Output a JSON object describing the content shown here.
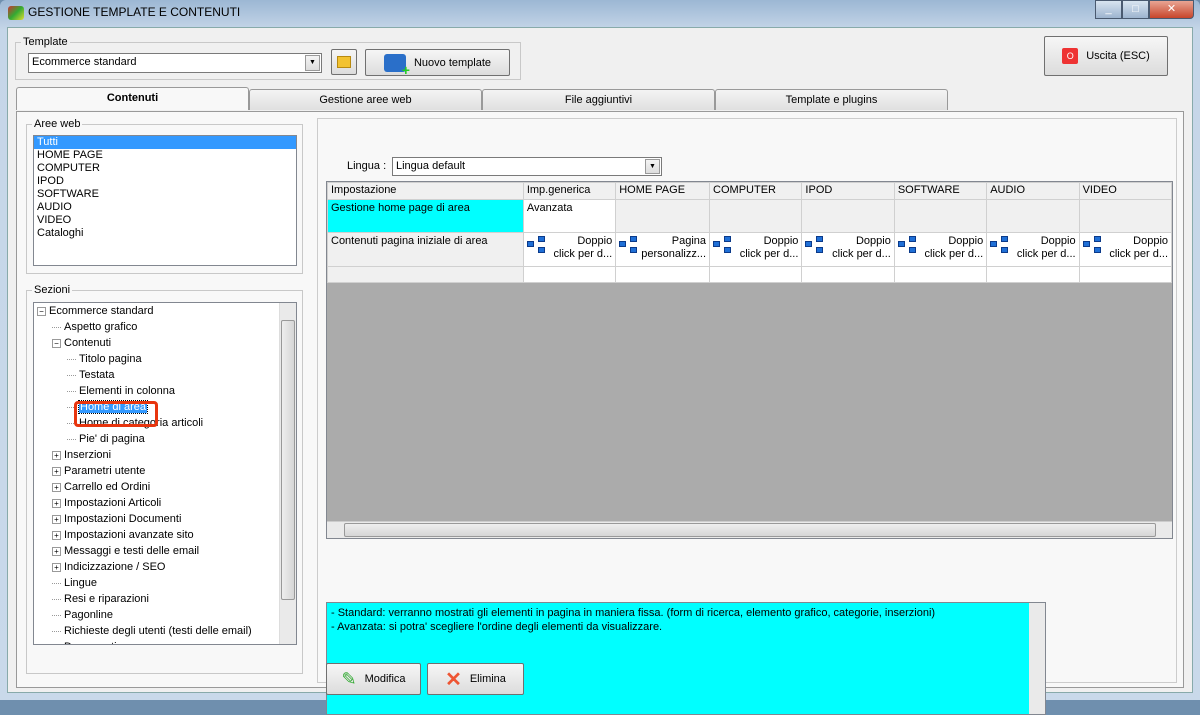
{
  "window": {
    "title": "GESTIONE TEMPLATE E CONTENUTI"
  },
  "template": {
    "legend": "Template",
    "selected": "Ecommerce standard",
    "new_label": "Nuovo template"
  },
  "exit_label": "Uscita (ESC)",
  "tabs": [
    "Contenuti",
    "Gestione aree web",
    "File aggiuntivi",
    "Template e plugins"
  ],
  "aree_web": {
    "legend": "Aree web",
    "items": [
      "Tutti",
      "HOME PAGE",
      "COMPUTER",
      "IPOD",
      "SOFTWARE",
      "AUDIO",
      "VIDEO",
      "Cataloghi"
    ]
  },
  "sezioni": {
    "legend": "Sezioni",
    "root": "Ecommerce standard",
    "aspetto": "Aspetto grafico",
    "contenuti": "Contenuti",
    "children": [
      "Titolo pagina",
      "Testata",
      "Elementi in colonna",
      "Home di area",
      "Home di categoria articoli",
      "Pie' di pagina"
    ],
    "collapsed": [
      "Inserzioni",
      "Parametri utente",
      "Carrello ed Ordini",
      "Impostazioni Articoli",
      "Impostazioni Documenti",
      "Impostazioni avanzate sito",
      "Messaggi e testi delle email",
      "Indicizzazione / SEO"
    ],
    "leaves": [
      "Lingue",
      "Resi e riparazioni",
      "Pagonline",
      "Richieste degli utenti (testi delle email)",
      "Documenti"
    ]
  },
  "lingua": {
    "label": "Lingua :",
    "selected": "Lingua default"
  },
  "grid": {
    "headers": [
      "Impostazione",
      "Imp.generica",
      "HOME PAGE",
      "COMPUTER",
      "IPOD",
      "SOFTWARE",
      "AUDIO",
      "VIDEO"
    ],
    "row1": {
      "label": "Gestione home page di area",
      "value": "Avanzata"
    },
    "row2": {
      "label": "Contenuti pagina iniziale di area",
      "cells": [
        [
          "Doppio",
          "click per d..."
        ],
        [
          "Pagina",
          "personalizz..."
        ],
        [
          "Doppio",
          "click per d..."
        ],
        [
          "Doppio",
          "click per d..."
        ],
        [
          "Doppio",
          "click per d..."
        ],
        [
          "Doppio",
          "click per d..."
        ],
        [
          "Doppio",
          "click per d..."
        ]
      ]
    }
  },
  "description": [
    "- Standard: verranno mostrati gli elementi in pagina in maniera fissa. (form di ricerca, elemento grafico, categorie, inserzioni)",
    "- Avanzata: si potra' scegliere l'ordine degli elementi da visualizzare."
  ],
  "buttons": {
    "modifica": "Modifica",
    "elimina": "Elimina"
  }
}
